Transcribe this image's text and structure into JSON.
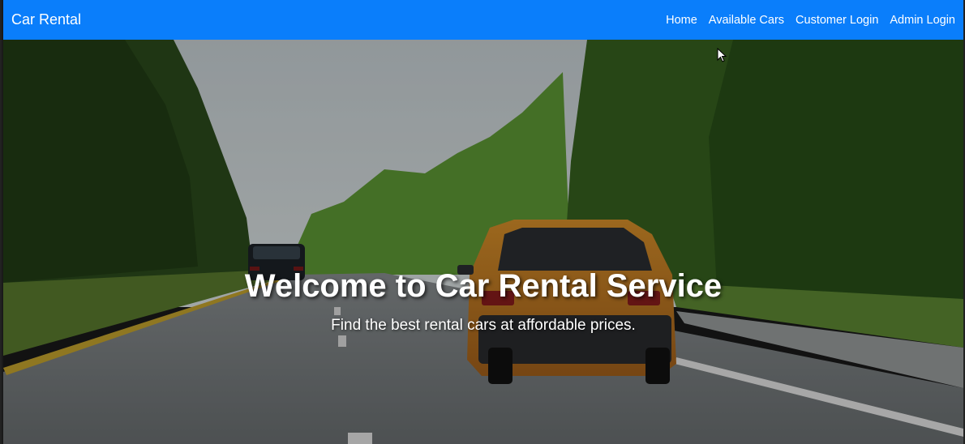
{
  "navbar": {
    "brand": "Car Rental",
    "links": [
      {
        "label": "Home"
      },
      {
        "label": "Available Cars"
      },
      {
        "label": "Customer Login"
      },
      {
        "label": "Admin Login"
      }
    ],
    "color": "#0a7efb"
  },
  "hero": {
    "title": "Welcome to Car Rental Service",
    "subtitle": "Find the best rental cars at affordable prices.",
    "background": "road-with-cars-image"
  }
}
